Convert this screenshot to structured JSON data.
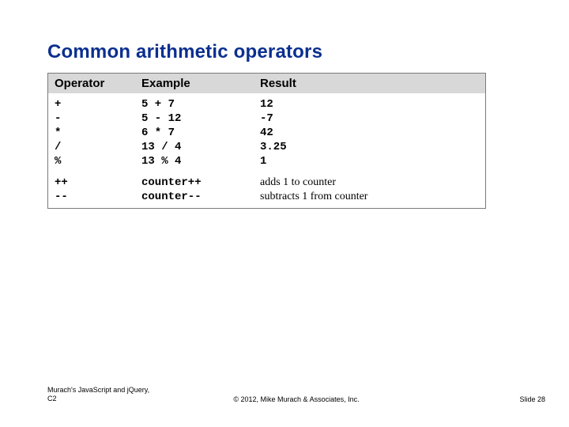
{
  "title": "Common arithmetic operators",
  "table": {
    "headers": {
      "c1": "Operator",
      "c2": "Example",
      "c3": "Result"
    },
    "rows": [
      {
        "op": "+",
        "ex": "5 + 7",
        "res": "12",
        "res_mono": true
      },
      {
        "op": "-",
        "ex": "5 - 12",
        "res": "-7",
        "res_mono": true
      },
      {
        "op": "*",
        "ex": "6 * 7",
        "res": "42",
        "res_mono": true
      },
      {
        "op": "/",
        "ex": "13 / 4",
        "res": "3.25",
        "res_mono": true
      },
      {
        "op": "%",
        "ex": "13 % 4",
        "res": "1",
        "res_mono": true
      },
      {
        "op": "++",
        "ex": "counter++",
        "res": "adds 1 to counter",
        "res_mono": false
      },
      {
        "op": "--",
        "ex": "counter--",
        "res": "subtracts 1 from counter",
        "res_mono": false
      }
    ]
  },
  "footer": {
    "left_line1": "Murach's JavaScript and jQuery,",
    "left_line2": "C2",
    "center": "© 2012, Mike Murach & Associates, Inc.",
    "right": "Slide 28"
  }
}
